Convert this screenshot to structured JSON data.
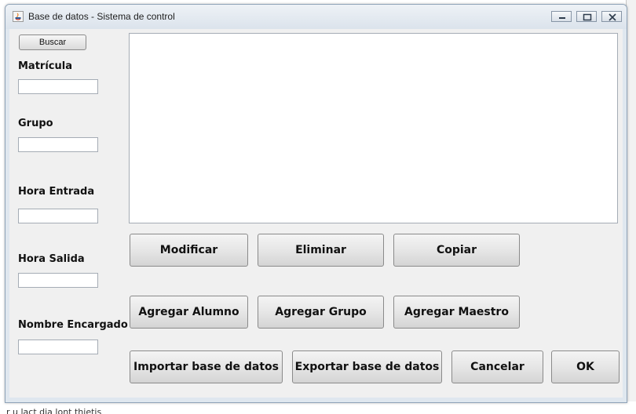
{
  "window": {
    "title": "Base de datos - Sistema de control"
  },
  "search": {
    "button_label": "Buscar"
  },
  "fields": [
    {
      "label": "Matrícula",
      "value": ""
    },
    {
      "label": "Grupo",
      "value": ""
    },
    {
      "label": "Hora Entrada",
      "value": ""
    },
    {
      "label": "Hora Salida",
      "value": ""
    },
    {
      "label": "Nombre Encargado",
      "value": ""
    }
  ],
  "results": {
    "text": ""
  },
  "actions": {
    "modificar": "Modificar",
    "eliminar": "Eliminar",
    "copiar": "Copiar",
    "agregar_alumno": "Agregar Alumno",
    "agregar_grupo": "Agregar Grupo",
    "agregar_maestro": "Agregar Maestro",
    "importar": "Importar base de datos",
    "exportar": "Exportar base de datos",
    "cancelar": "Cancelar",
    "ok": "OK"
  },
  "background": {
    "bottom_text": "r   u lact dia lont thietis"
  }
}
